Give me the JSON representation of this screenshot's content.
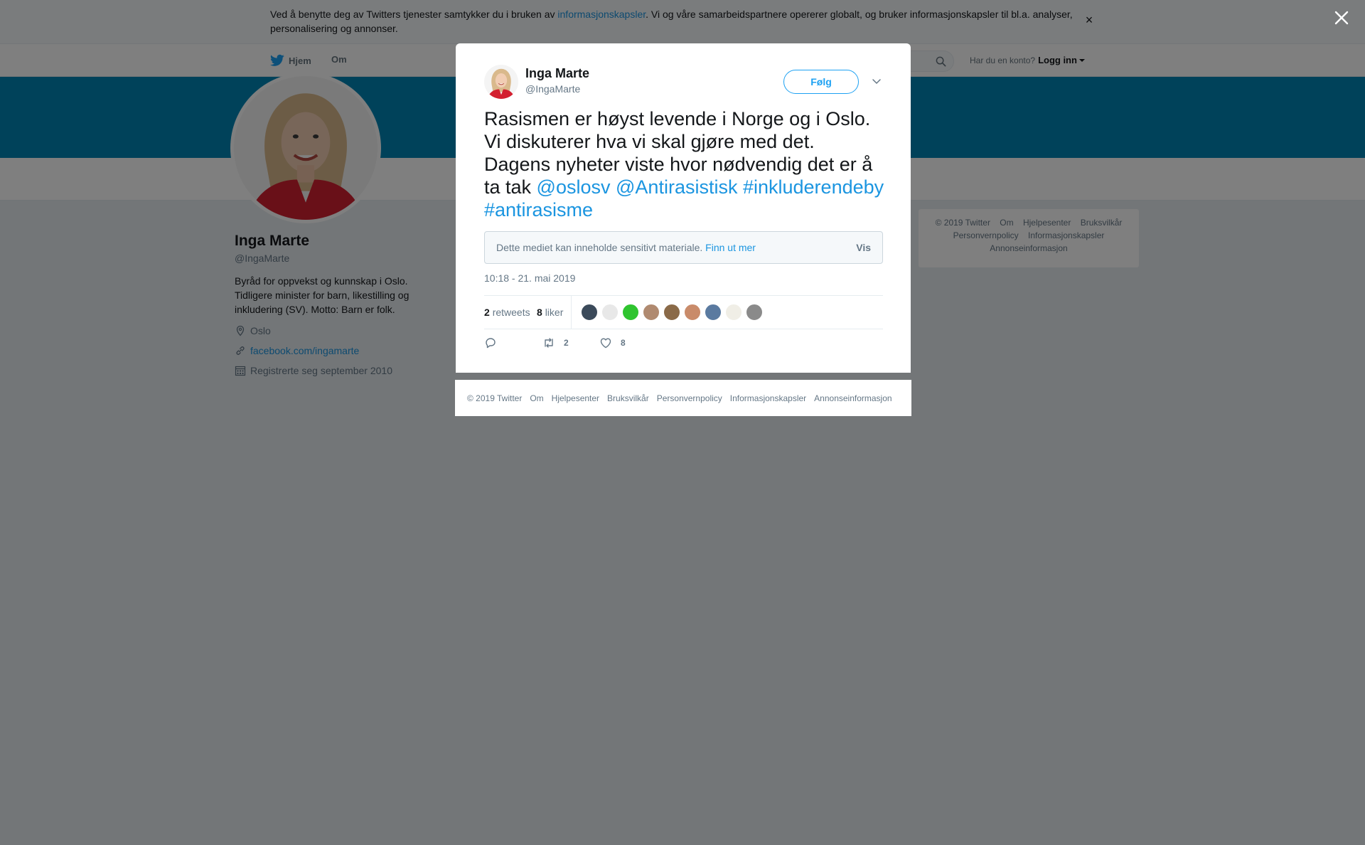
{
  "cookie_banner": {
    "text_before": "Ved å benytte deg av Twitters tjenester samtykker du i bruken av ",
    "link": "informasjonskapsler",
    "text_after": ". Vi og våre samarbeidspartnere opererer globalt, og bruker informasjonskapsler til bl.a. analyser, personalisering og annonser.",
    "close": "×"
  },
  "topnav": {
    "home": "Hjem",
    "about": "Om",
    "login_prompt": "Har du en konto?",
    "login": "Logg inn"
  },
  "profile": {
    "name": "Inga Marte",
    "handle": "@IngaMarte",
    "bio": "Byråd for oppvekst og kunnskap i Oslo. Tidligere minister for barn, likestilling og inkludering (SV). Motto: Barn er folk.",
    "location": "Oslo",
    "website": "facebook.com/ingamarte",
    "joined": "Registrerte seg september 2010"
  },
  "side_footer": {
    "items": [
      "© 2019 Twitter",
      "Om",
      "Hjelpesenter",
      "Bruksvilkår",
      "Personvernpolicy",
      "Informasjonskapsler",
      "Annonseinformasjon"
    ]
  },
  "tweet": {
    "author_name": "Inga Marte",
    "author_handle": "@IngaMarte",
    "follow_label": "Følg",
    "text": "Rasismen er høyst levende i Norge og i Oslo. Vi diskuterer hva vi skal gjøre med det. Dagens nyheter viste hvor nødvendig det er å ta tak ",
    "mention1": "@oslosv",
    "mention2": "@Antirasistisk",
    "hashtag1": "#inkluderendeby",
    "hashtag2": "#antirasisme",
    "sensitive_text": "Dette mediet kan inneholde sensitivt materiale. ",
    "sensitive_link": "Finn ut mer",
    "sensitive_show": "Vis",
    "timestamp": "10:18 - 21. mai 2019",
    "retweets_count": "2",
    "retweets_label": "retweets",
    "likes_count": "8",
    "likes_label": "liker",
    "action_retweets": "2",
    "action_likes": "8"
  },
  "likers": [
    {
      "color": "#3b4a5a"
    },
    {
      "color": "#e8e8e8"
    },
    {
      "color": "#2fc42f"
    },
    {
      "color": "#b08a70"
    },
    {
      "color": "#8a6a48"
    },
    {
      "color": "#c98b6a"
    },
    {
      "color": "#5a7aa0"
    },
    {
      "color": "#f0eee6"
    },
    {
      "color": "#8a8a8a"
    }
  ],
  "modal_footer": {
    "items": [
      "© 2019 Twitter",
      "Om",
      "Hjelpesenter",
      "Bruksvilkår",
      "Personvernpolicy",
      "Informasjonskapsler",
      "Annonseinformasjon"
    ]
  },
  "colors": {
    "banner": "#0084b4",
    "link": "#1b95e0",
    "follow": "#1da1f2"
  }
}
